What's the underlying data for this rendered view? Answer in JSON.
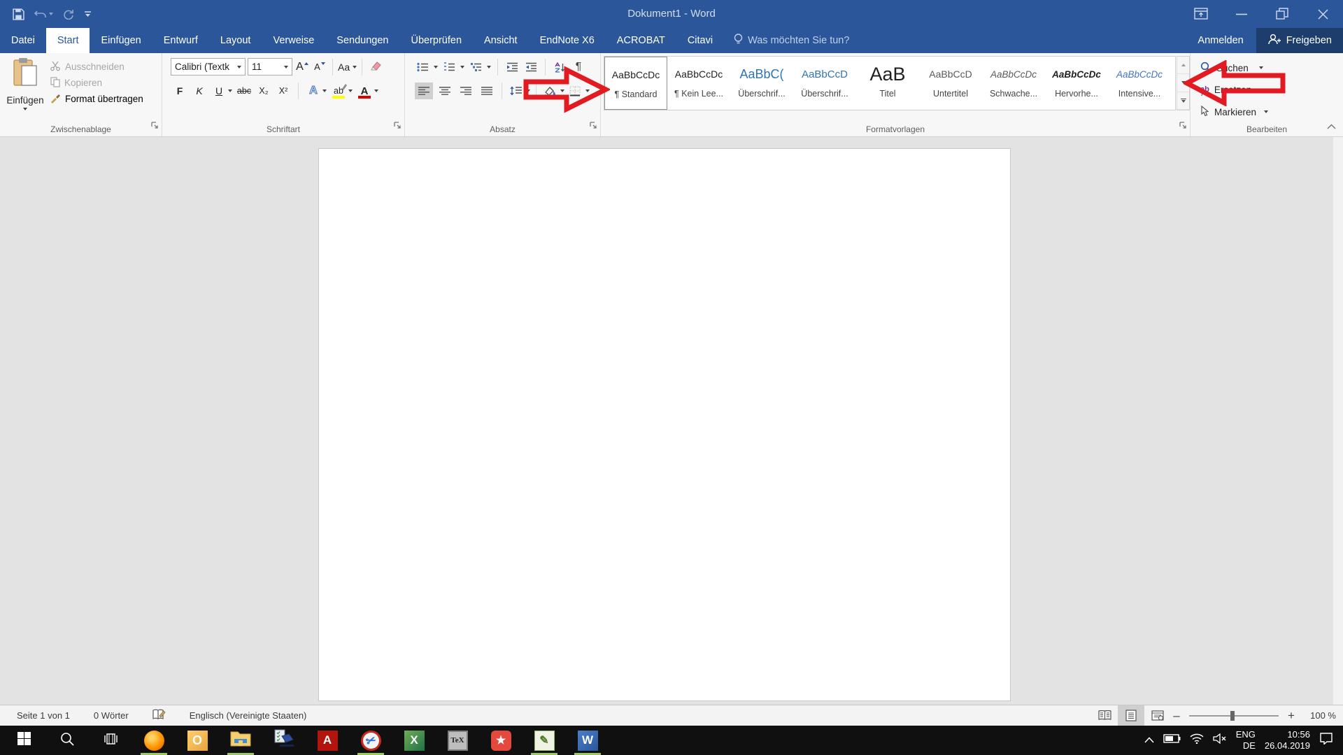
{
  "colors": {
    "accent_blue": "#2b579a",
    "share_button": "#1d3d6d",
    "arrow_red": "#e21b22",
    "heading_blue": "#2e74b5",
    "intensive_blue": "#4472c4",
    "taskbar_running_green": "#9dc95c",
    "highlight_yellow": "#ffff00",
    "font_color_red": "#e00000"
  },
  "titlebar": {
    "title": "Dokument1 - Word"
  },
  "tabs": {
    "items": [
      {
        "label": "Datei",
        "active": false
      },
      {
        "label": "Start",
        "active": true
      },
      {
        "label": "Einfügen",
        "active": false
      },
      {
        "label": "Entwurf",
        "active": false
      },
      {
        "label": "Layout",
        "active": false
      },
      {
        "label": "Verweise",
        "active": false
      },
      {
        "label": "Sendungen",
        "active": false
      },
      {
        "label": "Überprüfen",
        "active": false
      },
      {
        "label": "Ansicht",
        "active": false
      },
      {
        "label": "EndNote X6",
        "active": false
      },
      {
        "label": "ACROBAT",
        "active": false
      },
      {
        "label": "Citavi",
        "active": false
      }
    ],
    "tell_me": "Was möchten Sie tun?"
  },
  "account": {
    "sign_in": "Anmelden",
    "share": "Freigeben"
  },
  "ribbon": {
    "clipboard": {
      "paste": "Einfügen",
      "cut": "Ausschneiden",
      "copy": "Kopieren",
      "format_painter": "Format übertragen",
      "label": "Zwischenablage"
    },
    "font": {
      "name": "Calibri (Textk",
      "size": "11",
      "grow": "A",
      "shrink": "A",
      "case": "Aa",
      "bold": "F",
      "italic": "K",
      "underline": "U",
      "strike": "abc",
      "subscript": "X₂",
      "superscript": "X²",
      "effects": "A",
      "highlight": "ab",
      "color": "A",
      "label": "Schriftart"
    },
    "paragraph": {
      "pilcrow": "¶",
      "label": "Absatz"
    },
    "styles": {
      "label": "Formatvorlagen",
      "items": [
        {
          "preview": "AaBbCcDc",
          "label": "¶ Standard"
        },
        {
          "preview": "AaBbCcDc",
          "label": "¶ Kein Lee..."
        },
        {
          "preview": "AaBbC(",
          "label": "Überschrif..."
        },
        {
          "preview": "AaBbCcD",
          "label": "Überschrif..."
        },
        {
          "preview": "AaB",
          "label": "Titel"
        },
        {
          "preview": "AaBbCcD",
          "label": "Untertitel"
        },
        {
          "preview": "AaBbCcDc",
          "label": "Schwache..."
        },
        {
          "preview": "AaBbCcDc",
          "label": "Hervorhe..."
        },
        {
          "preview": "AaBbCcDc",
          "label": "Intensive..."
        }
      ]
    },
    "editing": {
      "find": "Suchen",
      "replace": "Ersetzen",
      "replace_icon_text": "ab",
      "select": "Markieren",
      "label": "Bearbeiten"
    }
  },
  "status": {
    "page": "Seite 1 von 1",
    "words": "0 Wörter",
    "language": "Englisch (Vereinigte Staaten)",
    "zoom": "100 %"
  },
  "taskbar": {
    "apps": [
      {
        "name": "firefox",
        "glyph": "",
        "running": true
      },
      {
        "name": "outlook",
        "glyph": "O",
        "running": false
      },
      {
        "name": "file-explorer",
        "glyph": "",
        "running": true
      },
      {
        "name": "devices",
        "glyph": "",
        "running": false
      },
      {
        "name": "acrobat-reader",
        "glyph": "A",
        "running": false
      },
      {
        "name": "snipping-tool",
        "glyph": "✂",
        "running": true
      },
      {
        "name": "excel",
        "glyph": "X",
        "running": false
      },
      {
        "name": "texmaker",
        "glyph": "TeX",
        "running": false
      },
      {
        "name": "wunderlist",
        "glyph": "★",
        "running": false
      },
      {
        "name": "notepad-plus-plus",
        "glyph": "✎",
        "running": true
      },
      {
        "name": "word",
        "glyph": "W",
        "running": true
      }
    ]
  },
  "tray": {
    "lang_top": "ENG",
    "lang_bottom": "DE",
    "time": "10:56",
    "date": "26.04.2019"
  }
}
